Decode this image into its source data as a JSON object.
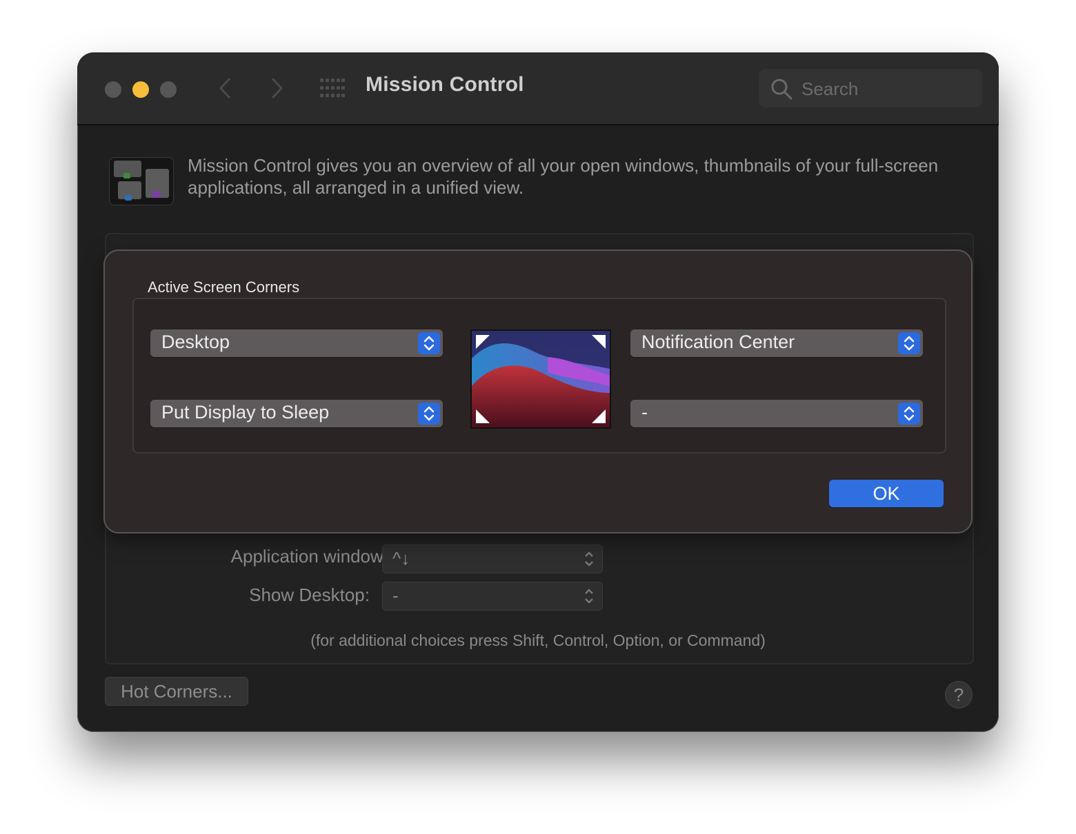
{
  "window": {
    "title": "Mission Control",
    "search_placeholder": "Search"
  },
  "description": "Mission Control gives you an overview of all your open windows, thumbnails of your full-screen applications, all arranged in a unified view.",
  "background_rows": [
    {
      "label": "Application windows:",
      "value": "^↓"
    },
    {
      "label": "Show Desktop:",
      "value": "-"
    }
  ],
  "hint": "(for additional choices press Shift, Control, Option, or Command)",
  "hot_corners_button": "Hot Corners...",
  "help_button": "?",
  "sheet": {
    "title": "Active Screen Corners",
    "top_left": "Desktop",
    "top_right": "Notification Center",
    "bottom_left": "Put Display to Sleep",
    "bottom_right": "-",
    "ok_label": "OK"
  },
  "colors": {
    "accent": "#2f6fe0",
    "minimize": "#f6be3b"
  }
}
